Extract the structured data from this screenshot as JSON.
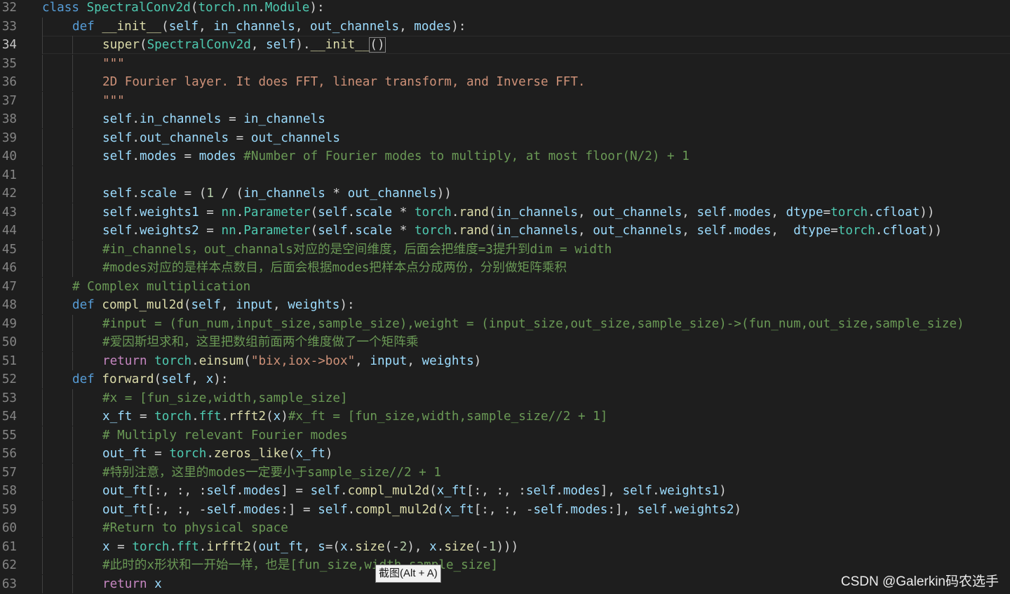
{
  "editor": {
    "current_line": 34,
    "lines": [
      {
        "n": "32",
        "indent": 0,
        "tokens": [
          [
            "kw",
            "class"
          ],
          [
            "op",
            " "
          ],
          [
            "cls",
            "SpectralConv2d"
          ],
          [
            "op",
            "("
          ],
          [
            "cls",
            "torch"
          ],
          [
            "op",
            "."
          ],
          [
            "cls",
            "nn"
          ],
          [
            "op",
            "."
          ],
          [
            "cls",
            "Module"
          ],
          [
            "op",
            "):"
          ]
        ]
      },
      {
        "n": "33",
        "indent": 1,
        "tokens": [
          [
            "kw",
            "def"
          ],
          [
            "op",
            " "
          ],
          [
            "fn",
            "__init__"
          ],
          [
            "op",
            "("
          ],
          [
            "var",
            "self"
          ],
          [
            "op",
            ", "
          ],
          [
            "var",
            "in_channels"
          ],
          [
            "op",
            ", "
          ],
          [
            "var",
            "out_channels"
          ],
          [
            "op",
            ", "
          ],
          [
            "var",
            "modes"
          ],
          [
            "op",
            "):"
          ]
        ]
      },
      {
        "n": "34",
        "indent": 2,
        "tokens": [
          [
            "fn",
            "super"
          ],
          [
            "op",
            "("
          ],
          [
            "cls",
            "SpectralConv2d"
          ],
          [
            "op",
            ", "
          ],
          [
            "var",
            "self"
          ],
          [
            "op",
            ")."
          ],
          [
            "fn",
            "__init__"
          ],
          [
            "box",
            "()"
          ]
        ]
      },
      {
        "n": "35",
        "indent": 2,
        "tokens": [
          [
            "str",
            "\"\"\""
          ]
        ]
      },
      {
        "n": "36",
        "indent": 2,
        "tokens": [
          [
            "str",
            "2D Fourier layer. It does FFT, linear transform, and Inverse FFT."
          ]
        ]
      },
      {
        "n": "37",
        "indent": 2,
        "tokens": [
          [
            "str",
            "\"\"\""
          ]
        ]
      },
      {
        "n": "38",
        "indent": 2,
        "tokens": [
          [
            "var",
            "self"
          ],
          [
            "op",
            "."
          ],
          [
            "var",
            "in_channels"
          ],
          [
            "op",
            " = "
          ],
          [
            "var",
            "in_channels"
          ]
        ]
      },
      {
        "n": "39",
        "indent": 2,
        "tokens": [
          [
            "var",
            "self"
          ],
          [
            "op",
            "."
          ],
          [
            "var",
            "out_channels"
          ],
          [
            "op",
            " = "
          ],
          [
            "var",
            "out_channels"
          ]
        ]
      },
      {
        "n": "40",
        "indent": 2,
        "tokens": [
          [
            "var",
            "self"
          ],
          [
            "op",
            "."
          ],
          [
            "var",
            "modes"
          ],
          [
            "op",
            " = "
          ],
          [
            "var",
            "modes"
          ],
          [
            "op",
            " "
          ],
          [
            "cm",
            "#Number of Fourier modes to multiply, at most floor(N/2) + 1"
          ]
        ]
      },
      {
        "n": "41",
        "indent": 2,
        "tokens": []
      },
      {
        "n": "42",
        "indent": 2,
        "tokens": [
          [
            "var",
            "self"
          ],
          [
            "op",
            "."
          ],
          [
            "var",
            "scale"
          ],
          [
            "op",
            " = ("
          ],
          [
            "num",
            "1"
          ],
          [
            "op",
            " / ("
          ],
          [
            "var",
            "in_channels"
          ],
          [
            "op",
            " * "
          ],
          [
            "var",
            "out_channels"
          ],
          [
            "op",
            "))"
          ]
        ]
      },
      {
        "n": "43",
        "indent": 2,
        "tokens": [
          [
            "var",
            "self"
          ],
          [
            "op",
            "."
          ],
          [
            "var",
            "weights1"
          ],
          [
            "op",
            " = "
          ],
          [
            "cls",
            "nn"
          ],
          [
            "op",
            "."
          ],
          [
            "cls",
            "Parameter"
          ],
          [
            "op",
            "("
          ],
          [
            "var",
            "self"
          ],
          [
            "op",
            "."
          ],
          [
            "var",
            "scale"
          ],
          [
            "op",
            " * "
          ],
          [
            "cls",
            "torch"
          ],
          [
            "op",
            "."
          ],
          [
            "fn",
            "rand"
          ],
          [
            "op",
            "("
          ],
          [
            "var",
            "in_channels"
          ],
          [
            "op",
            ", "
          ],
          [
            "var",
            "out_channels"
          ],
          [
            "op",
            ", "
          ],
          [
            "var",
            "self"
          ],
          [
            "op",
            "."
          ],
          [
            "var",
            "modes"
          ],
          [
            "op",
            ", "
          ],
          [
            "var",
            "dtype"
          ],
          [
            "op",
            "="
          ],
          [
            "cls",
            "torch"
          ],
          [
            "op",
            "."
          ],
          [
            "var",
            "cfloat"
          ],
          [
            "op",
            "))"
          ]
        ]
      },
      {
        "n": "44",
        "indent": 2,
        "tokens": [
          [
            "var",
            "self"
          ],
          [
            "op",
            "."
          ],
          [
            "var",
            "weights2"
          ],
          [
            "op",
            " = "
          ],
          [
            "cls",
            "nn"
          ],
          [
            "op",
            "."
          ],
          [
            "cls",
            "Parameter"
          ],
          [
            "op",
            "("
          ],
          [
            "var",
            "self"
          ],
          [
            "op",
            "."
          ],
          [
            "var",
            "scale"
          ],
          [
            "op",
            " * "
          ],
          [
            "cls",
            "torch"
          ],
          [
            "op",
            "."
          ],
          [
            "fn",
            "rand"
          ],
          [
            "op",
            "("
          ],
          [
            "var",
            "in_channels"
          ],
          [
            "op",
            ", "
          ],
          [
            "var",
            "out_channels"
          ],
          [
            "op",
            ", "
          ],
          [
            "var",
            "self"
          ],
          [
            "op",
            "."
          ],
          [
            "var",
            "modes"
          ],
          [
            "op",
            ",  "
          ],
          [
            "var",
            "dtype"
          ],
          [
            "op",
            "="
          ],
          [
            "cls",
            "torch"
          ],
          [
            "op",
            "."
          ],
          [
            "var",
            "cfloat"
          ],
          [
            "op",
            "))"
          ]
        ]
      },
      {
        "n": "45",
        "indent": 2,
        "tokens": [
          [
            "cm",
            "#in_channels，out_channals对应的是空间维度，后面会把维度=3提升到dim = width"
          ]
        ]
      },
      {
        "n": "46",
        "indent": 2,
        "tokens": [
          [
            "cm",
            "#modes对应的是样本点数目，后面会根据modes把样本点分成两份，分别做矩阵乘积"
          ]
        ]
      },
      {
        "n": "47",
        "indent": 1,
        "tokens": [
          [
            "cm",
            "# Complex multiplication"
          ]
        ]
      },
      {
        "n": "48",
        "indent": 1,
        "tokens": [
          [
            "kw",
            "def"
          ],
          [
            "op",
            " "
          ],
          [
            "fn",
            "compl_mul2d"
          ],
          [
            "op",
            "("
          ],
          [
            "var",
            "self"
          ],
          [
            "op",
            ", "
          ],
          [
            "var",
            "input"
          ],
          [
            "op",
            ", "
          ],
          [
            "var",
            "weights"
          ],
          [
            "op",
            "):"
          ]
        ]
      },
      {
        "n": "49",
        "indent": 2,
        "tokens": [
          [
            "cm",
            "#input = (fun_num,input_size,sample_size),weight = (input_size,out_size,sample_size)->(fun_num,out_size,sample_size)"
          ]
        ]
      },
      {
        "n": "50",
        "indent": 2,
        "tokens": [
          [
            "cm",
            "#爱因斯坦求和，这里把数组前面两个维度做了一个矩阵乘"
          ]
        ]
      },
      {
        "n": "51",
        "indent": 2,
        "tokens": [
          [
            "ctl",
            "return"
          ],
          [
            "op",
            " "
          ],
          [
            "cls",
            "torch"
          ],
          [
            "op",
            "."
          ],
          [
            "fn",
            "einsum"
          ],
          [
            "op",
            "("
          ],
          [
            "str",
            "\"bix,iox->box\""
          ],
          [
            "op",
            ", "
          ],
          [
            "var",
            "input"
          ],
          [
            "op",
            ", "
          ],
          [
            "var",
            "weights"
          ],
          [
            "op",
            ")"
          ]
        ]
      },
      {
        "n": "52",
        "indent": 1,
        "tokens": [
          [
            "kw",
            "def"
          ],
          [
            "op",
            " "
          ],
          [
            "fn",
            "forward"
          ],
          [
            "op",
            "("
          ],
          [
            "var",
            "self"
          ],
          [
            "op",
            ", "
          ],
          [
            "var",
            "x"
          ],
          [
            "op",
            "):"
          ]
        ]
      },
      {
        "n": "53",
        "indent": 2,
        "tokens": [
          [
            "cm",
            "#x = [fun_size,width,sample_size]"
          ]
        ]
      },
      {
        "n": "54",
        "indent": 2,
        "tokens": [
          [
            "var",
            "x_ft"
          ],
          [
            "op",
            " = "
          ],
          [
            "cls",
            "torch"
          ],
          [
            "op",
            "."
          ],
          [
            "cls",
            "fft"
          ],
          [
            "op",
            "."
          ],
          [
            "fn",
            "rfft2"
          ],
          [
            "op",
            "("
          ],
          [
            "var",
            "x"
          ],
          [
            "op",
            ")"
          ],
          [
            "cm",
            "#x_ft = [fun_size,width,sample_size//2 + 1]"
          ]
        ]
      },
      {
        "n": "55",
        "indent": 2,
        "tokens": [
          [
            "cm",
            "# Multiply relevant Fourier modes"
          ]
        ]
      },
      {
        "n": "56",
        "indent": 2,
        "tokens": [
          [
            "var",
            "out_ft"
          ],
          [
            "op",
            " = "
          ],
          [
            "cls",
            "torch"
          ],
          [
            "op",
            "."
          ],
          [
            "fn",
            "zeros_like"
          ],
          [
            "op",
            "("
          ],
          [
            "var",
            "x_ft"
          ],
          [
            "op",
            ")"
          ]
        ]
      },
      {
        "n": "57",
        "indent": 2,
        "tokens": [
          [
            "cm",
            "#特别注意，这里的modes一定要小于sample_size//2 + 1"
          ]
        ]
      },
      {
        "n": "58",
        "indent": 2,
        "tokens": [
          [
            "var",
            "out_ft"
          ],
          [
            "op",
            "[:, :, :"
          ],
          [
            "var",
            "self"
          ],
          [
            "op",
            "."
          ],
          [
            "var",
            "modes"
          ],
          [
            "op",
            "] = "
          ],
          [
            "var",
            "self"
          ],
          [
            "op",
            "."
          ],
          [
            "fn",
            "compl_mul2d"
          ],
          [
            "op",
            "("
          ],
          [
            "var",
            "x_ft"
          ],
          [
            "op",
            "[:, :, :"
          ],
          [
            "var",
            "self"
          ],
          [
            "op",
            "."
          ],
          [
            "var",
            "modes"
          ],
          [
            "op",
            "], "
          ],
          [
            "var",
            "self"
          ],
          [
            "op",
            "."
          ],
          [
            "var",
            "weights1"
          ],
          [
            "op",
            ")"
          ]
        ]
      },
      {
        "n": "59",
        "indent": 2,
        "tokens": [
          [
            "var",
            "out_ft"
          ],
          [
            "op",
            "[:, :, -"
          ],
          [
            "var",
            "self"
          ],
          [
            "op",
            "."
          ],
          [
            "var",
            "modes"
          ],
          [
            "op",
            ":] = "
          ],
          [
            "var",
            "self"
          ],
          [
            "op",
            "."
          ],
          [
            "fn",
            "compl_mul2d"
          ],
          [
            "op",
            "("
          ],
          [
            "var",
            "x_ft"
          ],
          [
            "op",
            "[:, :, -"
          ],
          [
            "var",
            "self"
          ],
          [
            "op",
            "."
          ],
          [
            "var",
            "modes"
          ],
          [
            "op",
            ":], "
          ],
          [
            "var",
            "self"
          ],
          [
            "op",
            "."
          ],
          [
            "var",
            "weights2"
          ],
          [
            "op",
            ")"
          ]
        ]
      },
      {
        "n": "60",
        "indent": 2,
        "tokens": [
          [
            "cm",
            "#Return to physical space"
          ]
        ]
      },
      {
        "n": "61",
        "indent": 2,
        "tokens": [
          [
            "var",
            "x"
          ],
          [
            "op",
            " = "
          ],
          [
            "cls",
            "torch"
          ],
          [
            "op",
            "."
          ],
          [
            "cls",
            "fft"
          ],
          [
            "op",
            "."
          ],
          [
            "fn",
            "irfft2"
          ],
          [
            "op",
            "("
          ],
          [
            "var",
            "out_ft"
          ],
          [
            "op",
            ", "
          ],
          [
            "var",
            "s"
          ],
          [
            "op",
            "=("
          ],
          [
            "var",
            "x"
          ],
          [
            "op",
            "."
          ],
          [
            "fn",
            "size"
          ],
          [
            "op",
            "(-"
          ],
          [
            "num",
            "2"
          ],
          [
            "op",
            "), "
          ],
          [
            "var",
            "x"
          ],
          [
            "op",
            "."
          ],
          [
            "fn",
            "size"
          ],
          [
            "op",
            "(-"
          ],
          [
            "num",
            "1"
          ],
          [
            "op",
            ")))"
          ]
        ]
      },
      {
        "n": "62",
        "indent": 2,
        "tokens": [
          [
            "cm",
            "#此时的x形状和一开始一样，也是[fun_size,width,sample_size]"
          ]
        ]
      },
      {
        "n": "63",
        "indent": 2,
        "tokens": [
          [
            "ctl",
            "return"
          ],
          [
            "op",
            " "
          ],
          [
            "var",
            "x"
          ]
        ]
      }
    ]
  },
  "tooltip": {
    "text": "截图(Alt + A)"
  },
  "watermark": {
    "text": "CSDN @Galerkin码农选手"
  }
}
